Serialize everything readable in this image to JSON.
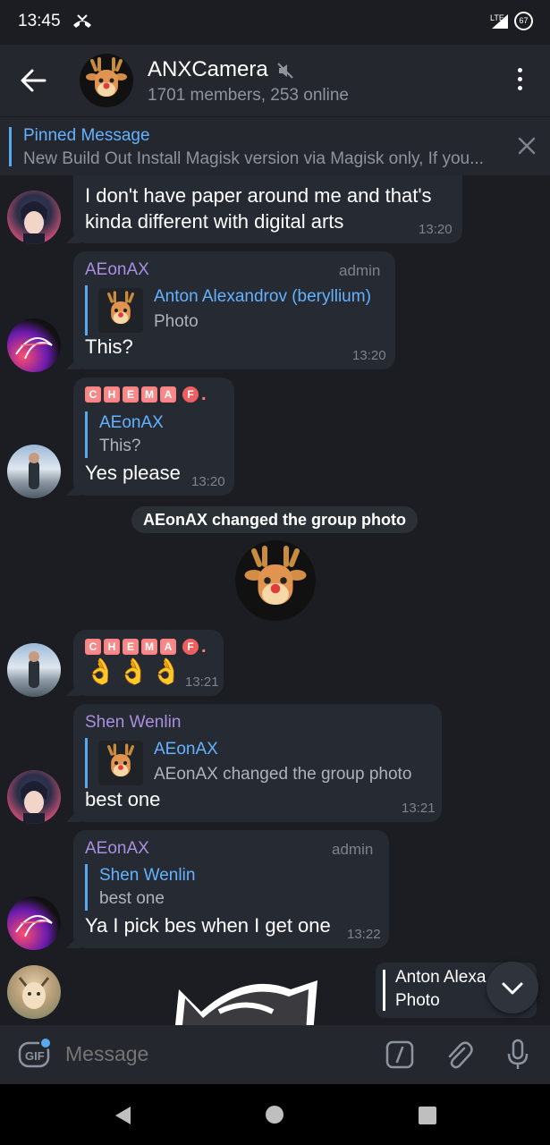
{
  "status_bar": {
    "time": "13:45",
    "network": "LTE",
    "battery": "67"
  },
  "header": {
    "title": "ANXCamera",
    "subtitle": "1701 members, 253 online"
  },
  "pinned": {
    "label": "Pinned Message",
    "text": "New Build Out  Install Magisk version via Magisk only, If you..."
  },
  "messages": [
    {
      "partial_top_text": "I don't have paper around me and that's kinda different with digital arts",
      "partial_line1": "I don't have paper around me and that's",
      "partial_line2": "kinda different with digital arts",
      "time": "13:20"
    },
    {
      "sender": "AEonAX",
      "role": "admin",
      "reply_name": "Anton Alexandrov (beryllium)",
      "reply_text": "Photo",
      "text": "This?",
      "time": "13:20"
    },
    {
      "sender_letters": [
        "C",
        "H",
        "E",
        "M",
        "A",
        "F",
        "."
      ],
      "reply_name": "AEonAX",
      "reply_text": "This?",
      "text": "Yes please",
      "time": "13:20"
    },
    {
      "service_text": "AEonAX changed the group photo"
    },
    {
      "sender_letters": [
        "C",
        "H",
        "E",
        "M",
        "A",
        "F",
        "."
      ],
      "text": "👌👌👌",
      "time": "13:21"
    },
    {
      "sender": "Shen Wenlin",
      "reply_name": "AEonAX",
      "reply_text": "AEonAX changed the group photo",
      "text": "best one",
      "time": "13:21"
    },
    {
      "sender": "AEonAX",
      "role": "admin",
      "reply_name": "Shen Wenlin",
      "reply_text": "best one",
      "text": "Ya I pick bes when I get one",
      "time": "13:22"
    },
    {
      "reply_name": "Anton Alexa",
      "reply_text": "Photo"
    }
  ],
  "composer": {
    "placeholder": "Message",
    "gif_label": "GIF",
    "cmd_label": "/"
  },
  "colors": {
    "background": "#1b1d22",
    "header": "#24272e",
    "bubble": "#262b33",
    "accent": "#64b2ff",
    "sender_purple": "#a98fe0"
  }
}
